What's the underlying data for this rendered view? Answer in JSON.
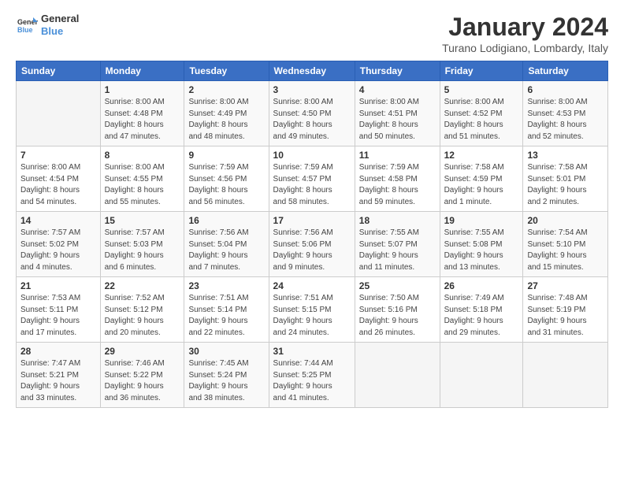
{
  "logo": {
    "line1": "General",
    "line2": "Blue"
  },
  "title": "January 2024",
  "location": "Turano Lodigiano, Lombardy, Italy",
  "weekdays": [
    "Sunday",
    "Monday",
    "Tuesday",
    "Wednesday",
    "Thursday",
    "Friday",
    "Saturday"
  ],
  "weeks": [
    [
      {
        "day": "",
        "info": ""
      },
      {
        "day": "1",
        "info": "Sunrise: 8:00 AM\nSunset: 4:48 PM\nDaylight: 8 hours\nand 47 minutes."
      },
      {
        "day": "2",
        "info": "Sunrise: 8:00 AM\nSunset: 4:49 PM\nDaylight: 8 hours\nand 48 minutes."
      },
      {
        "day": "3",
        "info": "Sunrise: 8:00 AM\nSunset: 4:50 PM\nDaylight: 8 hours\nand 49 minutes."
      },
      {
        "day": "4",
        "info": "Sunrise: 8:00 AM\nSunset: 4:51 PM\nDaylight: 8 hours\nand 50 minutes."
      },
      {
        "day": "5",
        "info": "Sunrise: 8:00 AM\nSunset: 4:52 PM\nDaylight: 8 hours\nand 51 minutes."
      },
      {
        "day": "6",
        "info": "Sunrise: 8:00 AM\nSunset: 4:53 PM\nDaylight: 8 hours\nand 52 minutes."
      }
    ],
    [
      {
        "day": "7",
        "info": "Sunrise: 8:00 AM\nSunset: 4:54 PM\nDaylight: 8 hours\nand 54 minutes."
      },
      {
        "day": "8",
        "info": "Sunrise: 8:00 AM\nSunset: 4:55 PM\nDaylight: 8 hours\nand 55 minutes."
      },
      {
        "day": "9",
        "info": "Sunrise: 7:59 AM\nSunset: 4:56 PM\nDaylight: 8 hours\nand 56 minutes."
      },
      {
        "day": "10",
        "info": "Sunrise: 7:59 AM\nSunset: 4:57 PM\nDaylight: 8 hours\nand 58 minutes."
      },
      {
        "day": "11",
        "info": "Sunrise: 7:59 AM\nSunset: 4:58 PM\nDaylight: 8 hours\nand 59 minutes."
      },
      {
        "day": "12",
        "info": "Sunrise: 7:58 AM\nSunset: 4:59 PM\nDaylight: 9 hours\nand 1 minute."
      },
      {
        "day": "13",
        "info": "Sunrise: 7:58 AM\nSunset: 5:01 PM\nDaylight: 9 hours\nand 2 minutes."
      }
    ],
    [
      {
        "day": "14",
        "info": "Sunrise: 7:57 AM\nSunset: 5:02 PM\nDaylight: 9 hours\nand 4 minutes."
      },
      {
        "day": "15",
        "info": "Sunrise: 7:57 AM\nSunset: 5:03 PM\nDaylight: 9 hours\nand 6 minutes."
      },
      {
        "day": "16",
        "info": "Sunrise: 7:56 AM\nSunset: 5:04 PM\nDaylight: 9 hours\nand 7 minutes."
      },
      {
        "day": "17",
        "info": "Sunrise: 7:56 AM\nSunset: 5:06 PM\nDaylight: 9 hours\nand 9 minutes."
      },
      {
        "day": "18",
        "info": "Sunrise: 7:55 AM\nSunset: 5:07 PM\nDaylight: 9 hours\nand 11 minutes."
      },
      {
        "day": "19",
        "info": "Sunrise: 7:55 AM\nSunset: 5:08 PM\nDaylight: 9 hours\nand 13 minutes."
      },
      {
        "day": "20",
        "info": "Sunrise: 7:54 AM\nSunset: 5:10 PM\nDaylight: 9 hours\nand 15 minutes."
      }
    ],
    [
      {
        "day": "21",
        "info": "Sunrise: 7:53 AM\nSunset: 5:11 PM\nDaylight: 9 hours\nand 17 minutes."
      },
      {
        "day": "22",
        "info": "Sunrise: 7:52 AM\nSunset: 5:12 PM\nDaylight: 9 hours\nand 20 minutes."
      },
      {
        "day": "23",
        "info": "Sunrise: 7:51 AM\nSunset: 5:14 PM\nDaylight: 9 hours\nand 22 minutes."
      },
      {
        "day": "24",
        "info": "Sunrise: 7:51 AM\nSunset: 5:15 PM\nDaylight: 9 hours\nand 24 minutes."
      },
      {
        "day": "25",
        "info": "Sunrise: 7:50 AM\nSunset: 5:16 PM\nDaylight: 9 hours\nand 26 minutes."
      },
      {
        "day": "26",
        "info": "Sunrise: 7:49 AM\nSunset: 5:18 PM\nDaylight: 9 hours\nand 29 minutes."
      },
      {
        "day": "27",
        "info": "Sunrise: 7:48 AM\nSunset: 5:19 PM\nDaylight: 9 hours\nand 31 minutes."
      }
    ],
    [
      {
        "day": "28",
        "info": "Sunrise: 7:47 AM\nSunset: 5:21 PM\nDaylight: 9 hours\nand 33 minutes."
      },
      {
        "day": "29",
        "info": "Sunrise: 7:46 AM\nSunset: 5:22 PM\nDaylight: 9 hours\nand 36 minutes."
      },
      {
        "day": "30",
        "info": "Sunrise: 7:45 AM\nSunset: 5:24 PM\nDaylight: 9 hours\nand 38 minutes."
      },
      {
        "day": "31",
        "info": "Sunrise: 7:44 AM\nSunset: 5:25 PM\nDaylight: 9 hours\nand 41 minutes."
      },
      {
        "day": "",
        "info": ""
      },
      {
        "day": "",
        "info": ""
      },
      {
        "day": "",
        "info": ""
      }
    ]
  ]
}
